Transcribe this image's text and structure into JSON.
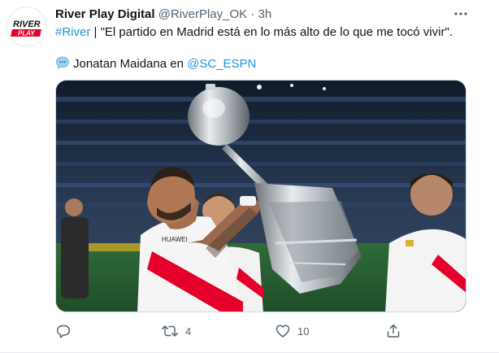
{
  "tweet": {
    "avatar_label": "RIVER PLAY",
    "display_name": "River Play Digital",
    "handle": "@RiverPlay_OK",
    "separator": "·",
    "time": "3h",
    "text": {
      "hashtag": "#River",
      "line1_rest": " | \"El partido en Madrid está en lo más alto de lo que me tocó vivir\".",
      "line2_prefix": "Jonatan Maidana en ",
      "mention": "@SC_ESPN"
    },
    "media": {
      "jersey_text": "HUAWEI"
    },
    "actions": {
      "reply_count": "",
      "retweet_count": "4",
      "like_count": "10"
    }
  },
  "colors": {
    "link": "#1b95e0",
    "secondary_text": "#536471",
    "river_red": "#e4002b"
  },
  "icons": [
    "more-icon",
    "speech-bubble-icon",
    "reply-icon",
    "retweet-icon",
    "like-icon",
    "share-icon"
  ]
}
